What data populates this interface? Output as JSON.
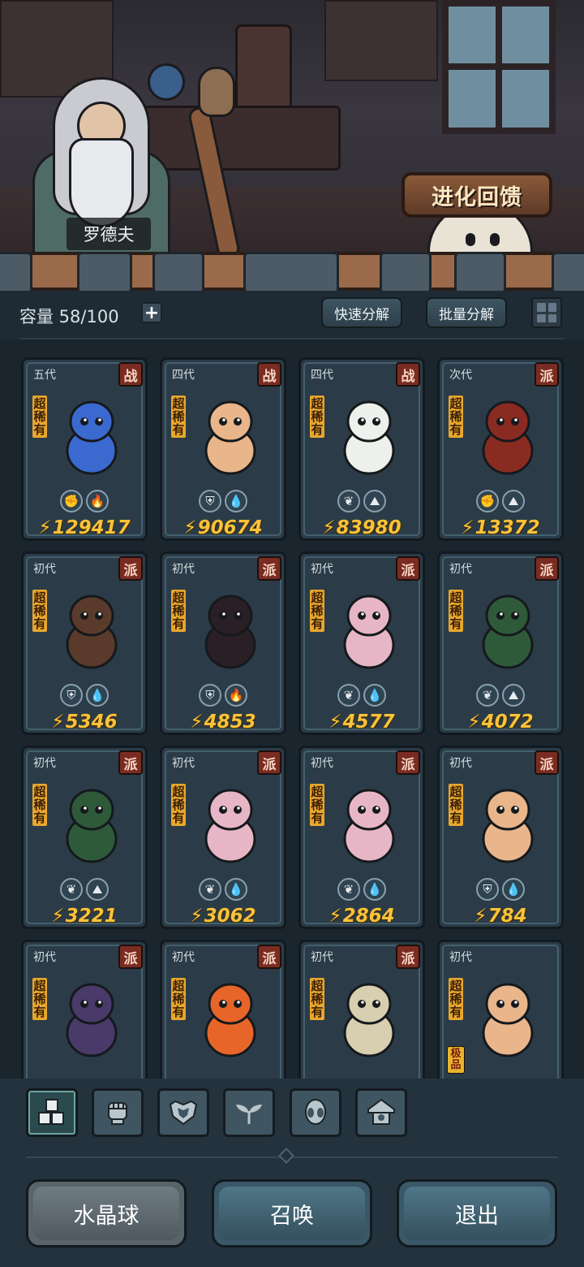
{
  "npc": {
    "name": "罗德夫"
  },
  "banner": {
    "evolution_label": "进化回馈"
  },
  "capacity": {
    "label": "容量 58/100",
    "plus": "+"
  },
  "toolbar": {
    "quick_decompose": "快速分解",
    "batch_decompose": "批量分解"
  },
  "cards": [
    {
      "gen": "五代",
      "tag": "战",
      "rarity": "超稀有",
      "power": "129417",
      "icons": [
        "fist-icon",
        "fire-icon"
      ],
      "color": "#3a6ad0"
    },
    {
      "gen": "四代",
      "tag": "战",
      "rarity": "超稀有",
      "power": "90674",
      "icons": [
        "shield-icon",
        "water-icon"
      ],
      "color": "#e9b58a"
    },
    {
      "gen": "四代",
      "tag": "战",
      "rarity": "超稀有",
      "power": "83980",
      "icons": [
        "leaf-icon",
        "earth-icon"
      ],
      "color": "#eef0ec"
    },
    {
      "gen": "次代",
      "tag": "派",
      "rarity": "超稀有",
      "power": "13372",
      "icons": [
        "fist-icon",
        "earth-icon"
      ],
      "color": "#8a2b22"
    },
    {
      "gen": "初代",
      "tag": "派",
      "rarity": "超稀有",
      "power": "5346",
      "icons": [
        "shield-icon",
        "water-icon"
      ],
      "color": "#5a3a2a"
    },
    {
      "gen": "初代",
      "tag": "派",
      "rarity": "超稀有",
      "power": "4853",
      "icons": [
        "shield-icon",
        "fire-icon"
      ],
      "color": "#2a1f24"
    },
    {
      "gen": "初代",
      "tag": "派",
      "rarity": "超稀有",
      "power": "4577",
      "icons": [
        "leaf-icon",
        "water-icon"
      ],
      "color": "#e7b6c6"
    },
    {
      "gen": "初代",
      "tag": "派",
      "rarity": "超稀有",
      "power": "4072",
      "icons": [
        "leaf-icon",
        "earth-icon"
      ],
      "color": "#2f5a3a"
    },
    {
      "gen": "初代",
      "tag": "派",
      "rarity": "超稀有",
      "power": "3221",
      "icons": [
        "leaf-icon",
        "earth-icon"
      ],
      "color": "#2f5a3a"
    },
    {
      "gen": "初代",
      "tag": "派",
      "rarity": "超稀有",
      "power": "3062",
      "icons": [
        "leaf-icon",
        "water-icon"
      ],
      "color": "#e7b6c6"
    },
    {
      "gen": "初代",
      "tag": "派",
      "rarity": "超稀有",
      "power": "2864",
      "icons": [
        "leaf-icon",
        "water-icon"
      ],
      "color": "#e7b6c6"
    },
    {
      "gen": "初代",
      "tag": "派",
      "rarity": "超稀有",
      "power": "784",
      "icons": [
        "shield-icon",
        "water-icon"
      ],
      "color": "#e9b58a"
    },
    {
      "gen": "初代",
      "tag": "派",
      "rarity": "超稀有",
      "power": "",
      "icons": [],
      "color": "#4a3a6a"
    },
    {
      "gen": "初代",
      "tag": "派",
      "rarity": "超稀有",
      "power": "",
      "icons": [],
      "color": "#e8652a"
    },
    {
      "gen": "初代",
      "tag": "派",
      "rarity": "超稀有",
      "power": "",
      "icons": [],
      "color": "#d8cfb0"
    },
    {
      "gen": "初代",
      "tag": "",
      "rarity": "超稀有",
      "extra": "极品",
      "power": "",
      "icons": [],
      "color": "#e9b58a"
    }
  ],
  "filter_tabs": [
    "all-tab",
    "fist-tab",
    "shield-tab",
    "leaf-tab",
    "alien-tab",
    "house-tab"
  ],
  "bottom_buttons": {
    "crystal_ball": "水晶球",
    "summon": "召唤",
    "exit": "退出"
  }
}
